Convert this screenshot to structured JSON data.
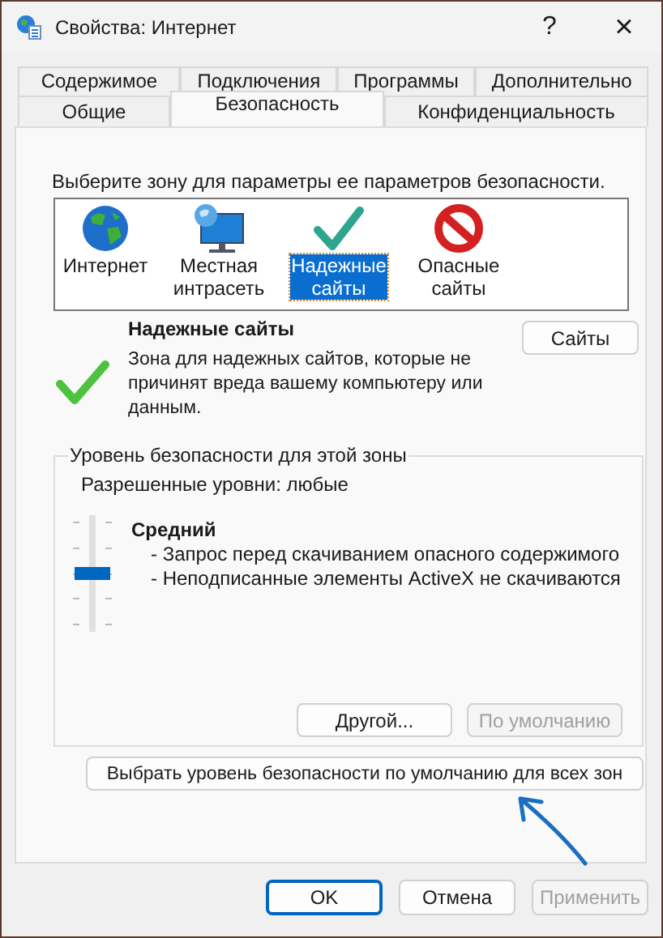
{
  "window": {
    "title": "Свойства: Интернет",
    "help": "?",
    "close": "×"
  },
  "tab_rows": [
    [
      {
        "label": "Содержимое",
        "selected": false
      },
      {
        "label": "Подключения",
        "selected": false
      },
      {
        "label": "Программы",
        "selected": false
      },
      {
        "label": "Дополнительно",
        "selected": false
      }
    ],
    [
      {
        "label": "Общие",
        "selected": false
      },
      {
        "label": "Безопасность",
        "selected": true
      },
      {
        "label": "Конфиденциальность",
        "selected": false
      }
    ]
  ],
  "zone_prompt": "Выберите зону для параметры ее параметров безопасности.",
  "zones": [
    {
      "label": "Интернет",
      "kind": "globe",
      "selected": false
    },
    {
      "label": "Местная\nинтрасеть",
      "kind": "intranet",
      "selected": false
    },
    {
      "label": "Надежные\nсайты",
      "kind": "trusted",
      "selected": true
    },
    {
      "label": "Опасные\nсайты",
      "kind": "restricted",
      "selected": false
    }
  ],
  "zone_info": {
    "title": "Надежные сайты",
    "description": "Зона для надежных сайтов, которые не причинят вреда вашему компьютеру или данным.",
    "button": "Сайты"
  },
  "security_level": {
    "legend": "Уровень безопасности для этой зоны",
    "allowed": "Разрешенные уровни: любые",
    "level": 0.5,
    "level_name": "Средний",
    "details": [
      "- Запрос перед скачиванием опасного содержимого",
      "- Неподписанные элементы ActiveX не скачиваются"
    ],
    "buttons": [
      {
        "label": "Другой...",
        "disabled": false
      },
      {
        "label": "По умолчанию",
        "disabled": true
      }
    ]
  },
  "reset_all_button": "Выбрать уровень безопасности по умолчанию для всех зон",
  "footer_buttons": [
    {
      "label": "OK",
      "disabled": false,
      "default": true
    },
    {
      "label": "Отмена",
      "disabled": false,
      "default": false
    },
    {
      "label": "Применить",
      "disabled": true,
      "default": false
    }
  ]
}
